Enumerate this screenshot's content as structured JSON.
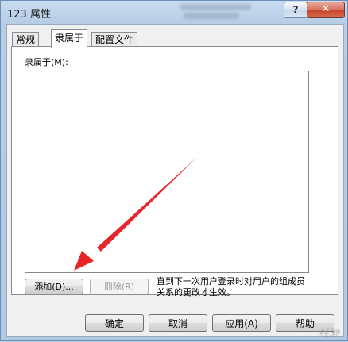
{
  "window": {
    "title": "123 属性",
    "help_glyph": "?",
    "close_glyph": "✕"
  },
  "tabs": [
    {
      "label": "常规"
    },
    {
      "label": "隶属于"
    },
    {
      "label": "配置文件"
    }
  ],
  "member_of": {
    "label": "隶属于(M):",
    "items": [],
    "add_button": "添加(D)...",
    "remove_button": "删除(R)",
    "note": "直到下一次用户登录时对用户的组成员关系的更改才生效。"
  },
  "dialog_buttons": {
    "ok": "确定",
    "cancel": "取消",
    "apply": "应用(A)",
    "help": "帮助"
  },
  "overlay": {
    "watermark": "经验",
    "arrow_color": "#e8262a"
  }
}
